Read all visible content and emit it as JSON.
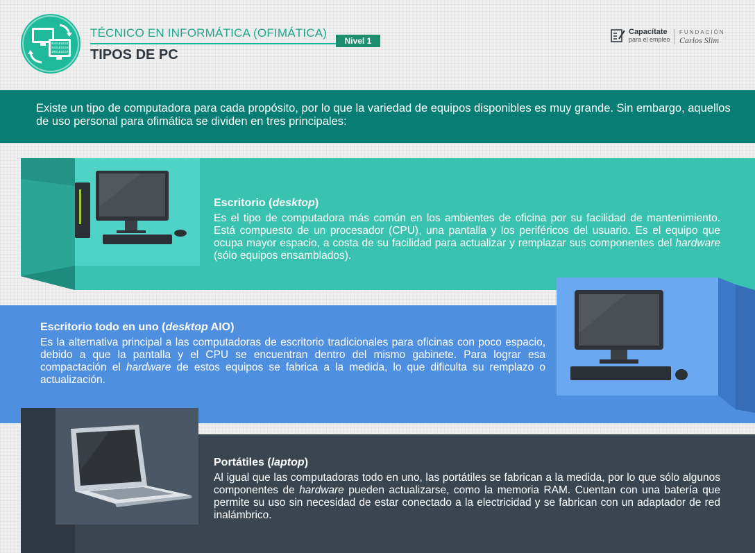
{
  "header": {
    "course_title": "TÉCNICO EN INFORMÁTICA (OFIMÁTICA)",
    "level_badge": "Nivel 1",
    "page_title": "TIPOS DE PC",
    "logo_binary": [
      "010101010",
      "010101010",
      "100101010"
    ]
  },
  "sponsor": {
    "name": "Capacítate",
    "tagline": "para el empleo",
    "foundation_top": "FUNDACIÓN",
    "foundation_name": "Carlos Slim"
  },
  "intro": {
    "text": "Existe un tipo de computadora para cada propósito, por lo que la variedad de equipos disponibles es muy grande. Sin embargo, aquellos de uso personal para ofimática se dividen en tres principales:"
  },
  "sections": [
    {
      "title_prefix": "Escritorio (",
      "title_em": "desktop",
      "title_suffix": ")",
      "body_1": "Es el tipo de computadora más común en los ambientes de oficina por su facilidad de mantenimiento. Está compuesto de un procesador (CPU), una pantalla y los periféricos del usuario. Es el equipo que ocupa mayor espacio, a costa de su facilidad para actualizar y remplazar sus componentes del ",
      "body_em": "hardware",
      "body_2": " (sólo equipos ensamblados).",
      "image_icon": "desktop-pc-icon"
    },
    {
      "title_prefix": "Escritorio todo en uno (",
      "title_em": "desktop",
      "title_suffix": " AIO)",
      "body_1": "Es la alternativa principal a las computadoras de escritorio tradicionales para oficinas con poco espacio, debido a que la pantalla y el CPU se encuentran dentro del mismo gabinete. Para lograr esa compactación el ",
      "body_em": "hardware",
      "body_2": " de estos equipos se fabrica a la medida, lo que dificulta su remplazo o actualización.",
      "image_icon": "all-in-one-pc-icon"
    },
    {
      "title_prefix": "Portátiles (",
      "title_em": "laptop",
      "title_suffix": ")",
      "body_1": "Al igual que las computadoras todo en uno, las portátiles se fabrican a la medida, por lo que sólo algunos componentes de ",
      "body_em": "hardware",
      "body_2": " pueden actualizarse, como la memoria RAM. Cuentan con una batería que permite su uso sin necesidad de estar conectado a la electricidad y se fabrican con un adaptador de red inalámbrico.",
      "image_icon": "laptop-icon"
    }
  ],
  "colors": {
    "teal_accent": "#1fb99b",
    "intro_band": "#087d73",
    "panel1": "#3ac2b0",
    "panel2": "#4f8fe0",
    "panel3": "#3a4552"
  }
}
